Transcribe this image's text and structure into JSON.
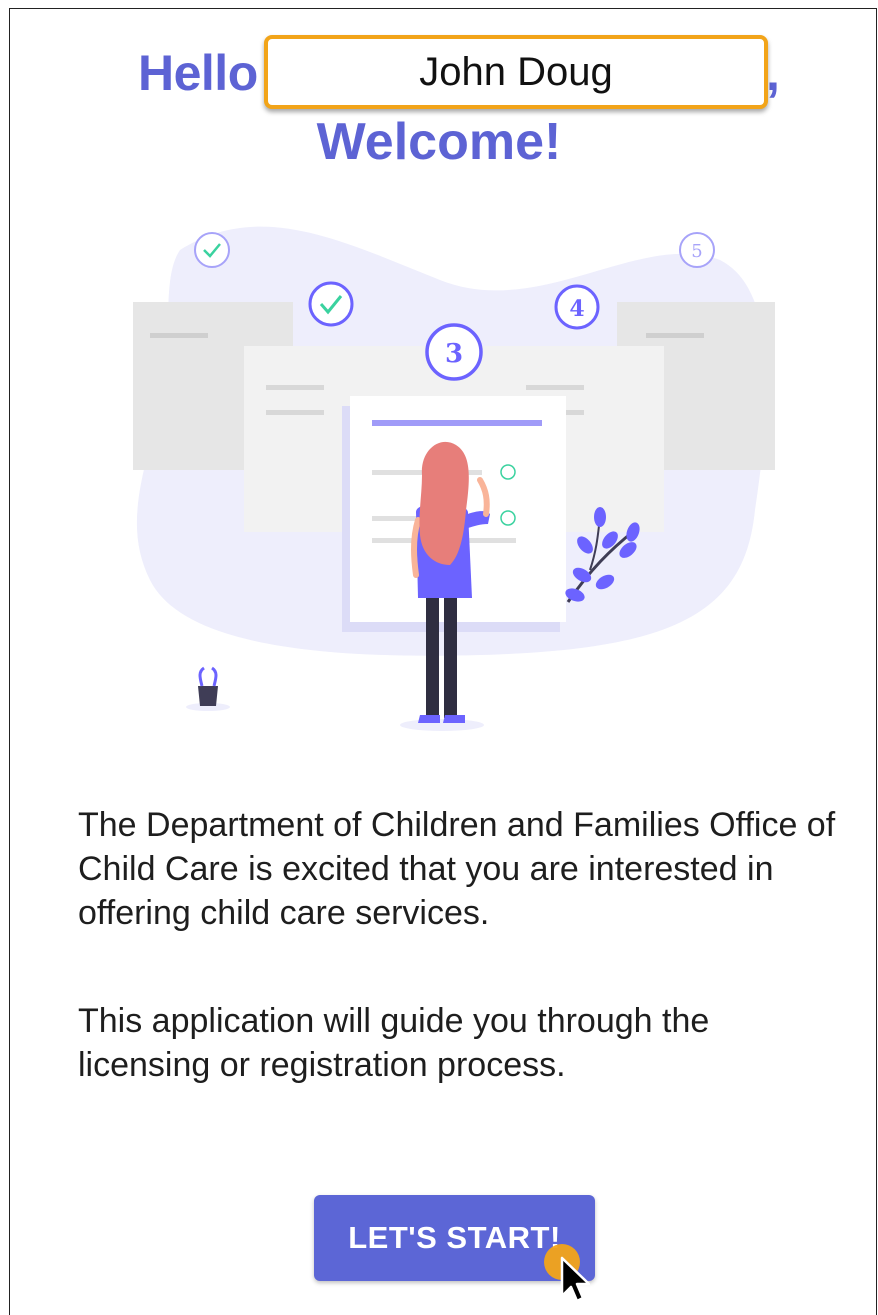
{
  "header": {
    "greeting": "Hello",
    "greeting_suffix": ",",
    "welcome": "Welcome!"
  },
  "name_field": {
    "value": "John Doug"
  },
  "illustration": {
    "steps": [
      "3",
      "4",
      "5"
    ],
    "accent_color": "#6c63ff",
    "blob_color": "#eeeefc",
    "check_color": "#3ad29f"
  },
  "body": {
    "intro": "The Department of Children and Families Office of Child Care is excited that you are interested in offering child care services.",
    "guide": "This application will guide you through the licensing or registration process."
  },
  "actions": {
    "start_label": "LET'S START!"
  },
  "colors": {
    "primary": "#5c66d6",
    "highlight": "#f2a419"
  }
}
